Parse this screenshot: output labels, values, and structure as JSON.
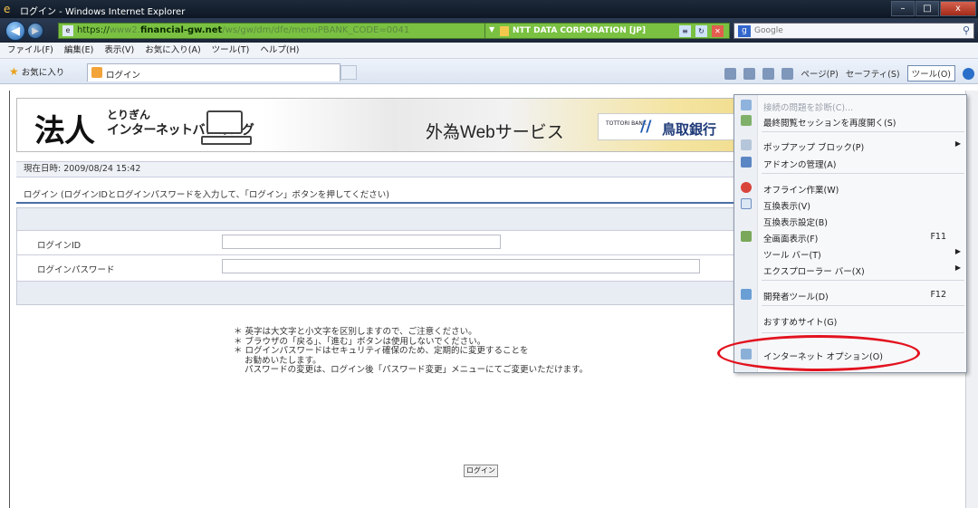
{
  "window": {
    "title": "ログイン - Windows Internet Explorer",
    "controls": [
      "–",
      "□",
      "x"
    ]
  },
  "address": {
    "url_prefix": "https://",
    "url_domain": "financial-gw.net",
    "url_rest": "/ws/gw/dm/dfe/menuPBANK_CODE=0041",
    "cert": "NTT DATA CORPORATION [JP]",
    "search_provider": "Google",
    "search_placeholder": "Google"
  },
  "menubar": [
    "ファイル(F)",
    "編集(E)",
    "表示(V)",
    "お気に入り(A)",
    "ツール(T)",
    "ヘルプ(H)"
  ],
  "favorites": {
    "label": "お気に入り",
    "tab_title": "ログイン"
  },
  "commands": {
    "page": "ページ(P)",
    "safety": "セーフティ(S)",
    "tools": "ツール(O)"
  },
  "banner": {
    "logo_main": "法人",
    "logo_small": "とりぎん",
    "logo_sub": "インターネットバンキング",
    "service": "外為Webサービス",
    "bank_small": "TOTTORI BANK",
    "bank_name": "鳥取銀行"
  },
  "datetime": "現在日時:  2009/08/24 15:42",
  "login": {
    "heading": "ログイン (ログインIDとログインパスワードを入力して、「ログイン」ボタンを押してください)",
    "id_label": "ログインID",
    "password_label": "ログインパスワード",
    "id_value": "",
    "password_value": ""
  },
  "notes": "＊ 英字は大文字と小文字を区別しますので、ご注意ください。\n＊ ブラウザの「戻る」、「進む」ボタンは使用しないでください。\n＊ ログインパスワードはセキュリティ確保のため、定期的に変更することを\n    お勧めいたします。\n    パスワードの変更は、ログイン後「パスワード変更」メニューにてご変更いただけます。",
  "login_button": "ログイン",
  "tools_menu": [
    {
      "label": "接続の問題を診断(C)...",
      "disabled": true,
      "icon": "diagnose-icon"
    },
    {
      "label": "最終閲覧セッションを再度開く(S)",
      "disabled": false,
      "icon": "reopen-session-icon"
    },
    {
      "label": "ポップアップ ブロック(P)",
      "disabled": false,
      "icon": "popup-block-icon",
      "submenu": true
    },
    {
      "label": "アドオンの管理(A)",
      "disabled": false,
      "icon": "addons-icon"
    },
    {
      "label": "オフライン作業(W)",
      "disabled": false,
      "icon": "offline-icon"
    },
    {
      "label": "互換表示(V)",
      "disabled": false,
      "icon": "compat-view-icon"
    },
    {
      "label": "互換表示設定(B)",
      "disabled": false,
      "icon": ""
    },
    {
      "label": "全画面表示(F)",
      "disabled": false,
      "icon": "fullscreen-icon",
      "key": "F11"
    },
    {
      "label": "ツール バー(T)",
      "disabled": false,
      "icon": "",
      "submenu": true
    },
    {
      "label": "エクスプローラー バー(X)",
      "disabled": false,
      "icon": "",
      "submenu": true
    },
    {
      "label": "開発者ツール(D)",
      "disabled": false,
      "icon": "developer-tools-icon",
      "key": "F12"
    },
    {
      "label": "おすすめサイト(G)",
      "disabled": false,
      "icon": ""
    },
    {
      "label": "インターネット オプション(O)",
      "disabled": false,
      "icon": "internet-options-icon"
    }
  ],
  "colors": {
    "address_bar_secure": "#7ac142",
    "highlight_ring": "#e2131f",
    "heading_rule": "#4b6fa7"
  }
}
